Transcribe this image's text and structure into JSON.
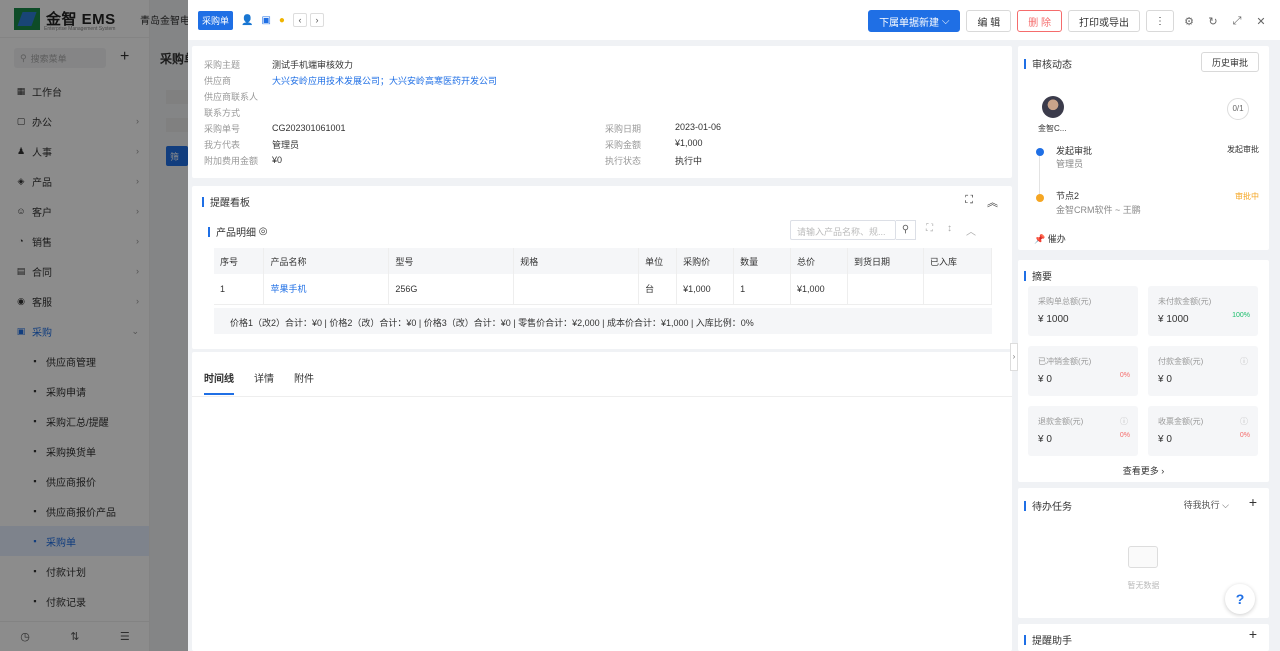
{
  "bg": {
    "logo_text": "金智 EMS",
    "logo_sub": "Enterprise Management System",
    "company": "青岛金智电子",
    "search_placeholder": "搜索菜单",
    "page_title": "采购单",
    "btn_text": "筛",
    "menu": [
      {
        "label": "工作台",
        "icon": "▦"
      },
      {
        "label": "办公",
        "icon": "▢"
      },
      {
        "label": "人事",
        "icon": "♟"
      },
      {
        "label": "产品",
        "icon": "◈"
      },
      {
        "label": "客户",
        "icon": "☺"
      },
      {
        "label": "销售",
        "icon": "◔"
      },
      {
        "label": "合同",
        "icon": "▤"
      },
      {
        "label": "客服",
        "icon": "◉"
      },
      {
        "label": "采购",
        "icon": "▣"
      }
    ],
    "submenu": [
      {
        "label": "供应商管理"
      },
      {
        "label": "采购申请"
      },
      {
        "label": "采购汇总/提醒"
      },
      {
        "label": "采购换货单"
      },
      {
        "label": "供应商报价"
      },
      {
        "label": "供应商报价产品"
      },
      {
        "label": "采购单"
      },
      {
        "label": "付款计划"
      },
      {
        "label": "付款记录"
      }
    ]
  },
  "topbar": {
    "tag": "采购单",
    "new_sub_btn": "下属单据新建",
    "edit_btn": "编 辑",
    "delete_btn": "删 除",
    "print_btn": "打印或导出",
    "more_btn": "⋮"
  },
  "info": {
    "subject_label": "采购主题",
    "subject": "测试手机端审核效力",
    "supplier_label": "供应商",
    "supplier": "大兴安岭应用技术发展公司；大兴安岭高寒医药开发公司",
    "contact_label": "供应商联系人",
    "contact": "",
    "contact_way_label": "联系方式",
    "contact_way": "",
    "order_no_label": "采购单号",
    "order_no": "CG202301061001",
    "our_rep_label": "我方代表",
    "our_rep": "管理员",
    "extra_fee_label": "附加费用金额",
    "extra_fee": "¥0",
    "date_label": "采购日期",
    "date": "2023-01-06",
    "amount_label": "采购金额",
    "amount": "¥1,000",
    "status_label": "执行状态",
    "status": "执行中"
  },
  "remind": {
    "title": "提醒看板",
    "product_title": "产品明细",
    "search_placeholder": "请输入产品名称、规...",
    "columns": [
      "序号",
      "产品名称",
      "型号",
      "规格",
      "单位",
      "采购价",
      "数量",
      "总价",
      "到货日期",
      "已入库"
    ],
    "rows": [
      [
        "1",
        "苹果手机",
        "256G",
        "",
        "台",
        "¥1,000",
        "1",
        "¥1,000",
        "",
        ""
      ]
    ],
    "summary": "价格1（改2）合计：¥0 |   价格2（改）合计：¥0 |   价格3（改）合计：¥0 |   零售价合计：¥2,000 |   成本价合计：¥1,000 |   入库比例：0%"
  },
  "tabs": [
    {
      "label": "时间线"
    },
    {
      "label": "详情"
    },
    {
      "label": "附件"
    }
  ],
  "approval": {
    "title": "审核动态",
    "history_btn": "历史审批",
    "avatar_name": "金智C...",
    "counter": "0/1",
    "step1_title": "发起审批",
    "step1_sub": "管理员",
    "step1_right": "发起审批",
    "step2_title": "节点2",
    "step2_sub": "金智CRM软件 ~ 王鹏",
    "step2_right": "审批中",
    "urge": "催办"
  },
  "summary": {
    "title": "摘要",
    "kpis": [
      {
        "label": "采购单总额(元)",
        "value": "¥ 1000",
        "pct": ""
      },
      {
        "label": "未付款金额(元)",
        "value": "¥ 1000",
        "pct": "100%"
      },
      {
        "label": "已冲销金额(元)",
        "value": "¥ 0",
        "pct": "0%"
      },
      {
        "label": "付款金额(元)",
        "value": "¥ 0",
        "pct": ""
      },
      {
        "label": "退款金额(元)",
        "value": "¥ 0",
        "pct": "0%"
      },
      {
        "label": "收票金额(元)",
        "value": "¥ 0",
        "pct": "0%"
      }
    ],
    "see_more": "查看更多 ›"
  },
  "tasks": {
    "title": "待办任务",
    "filter": "待我执行 ⌵",
    "empty": "暂无数据"
  },
  "helper": {
    "title": "提醒助手"
  },
  "colors": {
    "accent": "#1f6fe5",
    "danger": "#f56c6c",
    "success": "#19be6b",
    "warning": "#f5a623"
  }
}
